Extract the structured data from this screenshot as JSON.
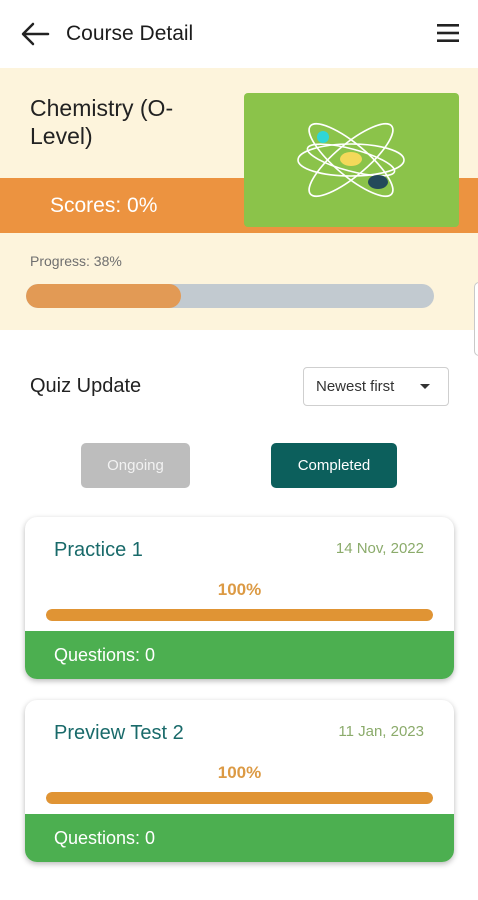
{
  "header": {
    "title": "Course Detail",
    "back_icon": "arrow-left-icon",
    "menu_icon": "hamburger-menu-icon"
  },
  "course": {
    "name": "Chemistry (O-Level)",
    "scores_text": "Scores: 0%",
    "progress_text": "Progress: 38%",
    "progress_value": 0.38,
    "image_icon": "atom-icon",
    "colors": {
      "banner": "#fdf4dc",
      "score_strip": "#ec9340",
      "image_bg": "#8bc34a",
      "progress_fill": "#e29a55",
      "progress_track": "#c2cad0"
    }
  },
  "quiz": {
    "heading": "Quiz Update",
    "sort": {
      "selected": "Newest first"
    },
    "tabs": [
      {
        "label": "Ongoing",
        "active": false
      },
      {
        "label": "Completed",
        "active": true
      }
    ],
    "items": [
      {
        "title": "Practice 1",
        "date": "14 Nov, 2022",
        "percent_text": "100%",
        "progress": 1.0,
        "questions_text": "Questions: 0"
      },
      {
        "title": "Preview Test 2",
        "date": "11 Jan, 2023",
        "percent_text": "100%",
        "progress": 1.0,
        "questions_text": "Questions: 0"
      }
    ],
    "colors": {
      "active_tab": "#0c5f5c",
      "inactive_tab": "#bdbdbd",
      "card_footer": "#4caf50",
      "card_bar": "#e09434",
      "card_title": "#196a6a"
    }
  }
}
